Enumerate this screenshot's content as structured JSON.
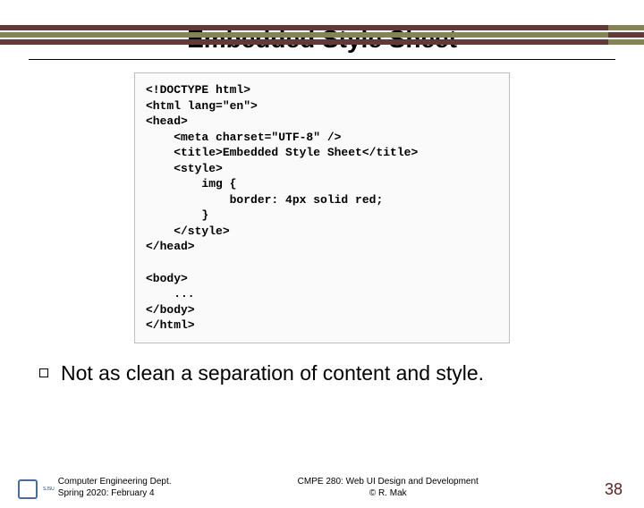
{
  "colors": {
    "band_dark": "#5f3a37",
    "band_olive": "#838355",
    "page_num": "#5f1d1d"
  },
  "title": "Embedded Style Sheet",
  "code": "<!DOCTYPE html>\n<html lang=\"en\">\n<head>\n    <meta charset=\"UTF-8\" />\n    <title>Embedded Style Sheet</title>\n    <style>\n        img {\n            border: 4px solid red;\n        }\n    </style>\n</head>\n\n<body>\n    ...\n</body>\n</html>",
  "bullet": "Not as clean a separation of content and style.",
  "footer": {
    "logo_text": "SJSU",
    "left_line1": "Computer Engineering Dept.",
    "left_line2": "Spring 2020: February 4",
    "center_line1": "CMPE 280: Web UI Design and Development",
    "center_line2": "© R. Mak",
    "page": "38"
  }
}
